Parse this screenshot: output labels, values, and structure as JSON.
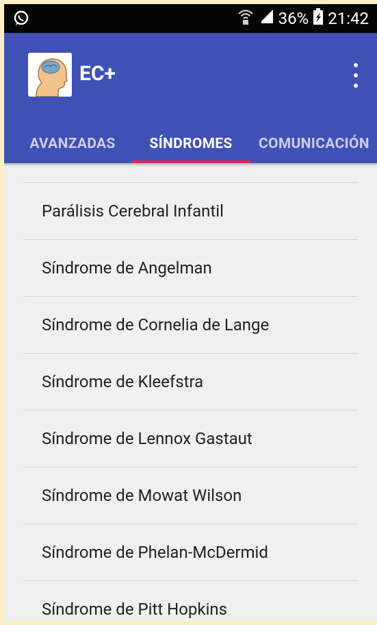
{
  "statusbar": {
    "battery": "36%",
    "time": "21:42",
    "icons": [
      "whatsapp-icon",
      "wifi-icon",
      "signal-icon",
      "battery-icon"
    ]
  },
  "appbar": {
    "title": "EC+",
    "logo": "head-brain-logo",
    "background": "#3f51b5"
  },
  "tabs": [
    {
      "label": "AVANZADAS",
      "selected": false
    },
    {
      "label": "SÍNDROMES",
      "selected": true
    },
    {
      "label": "COMUNICACIÓN",
      "selected": false
    }
  ],
  "accent": "#e91e63",
  "list": {
    "items": [
      "Parálisis Cerebral Infantil",
      "Síndrome de Angelman",
      "Síndrome de Cornelia de Lange",
      "Síndrome de Kleefstra",
      "Síndrome de Lennox Gastaut",
      "Síndrome de Mowat Wilson",
      "Síndrome de Phelan-McDermid",
      "Síndrome de Pitt Hopkins"
    ]
  }
}
